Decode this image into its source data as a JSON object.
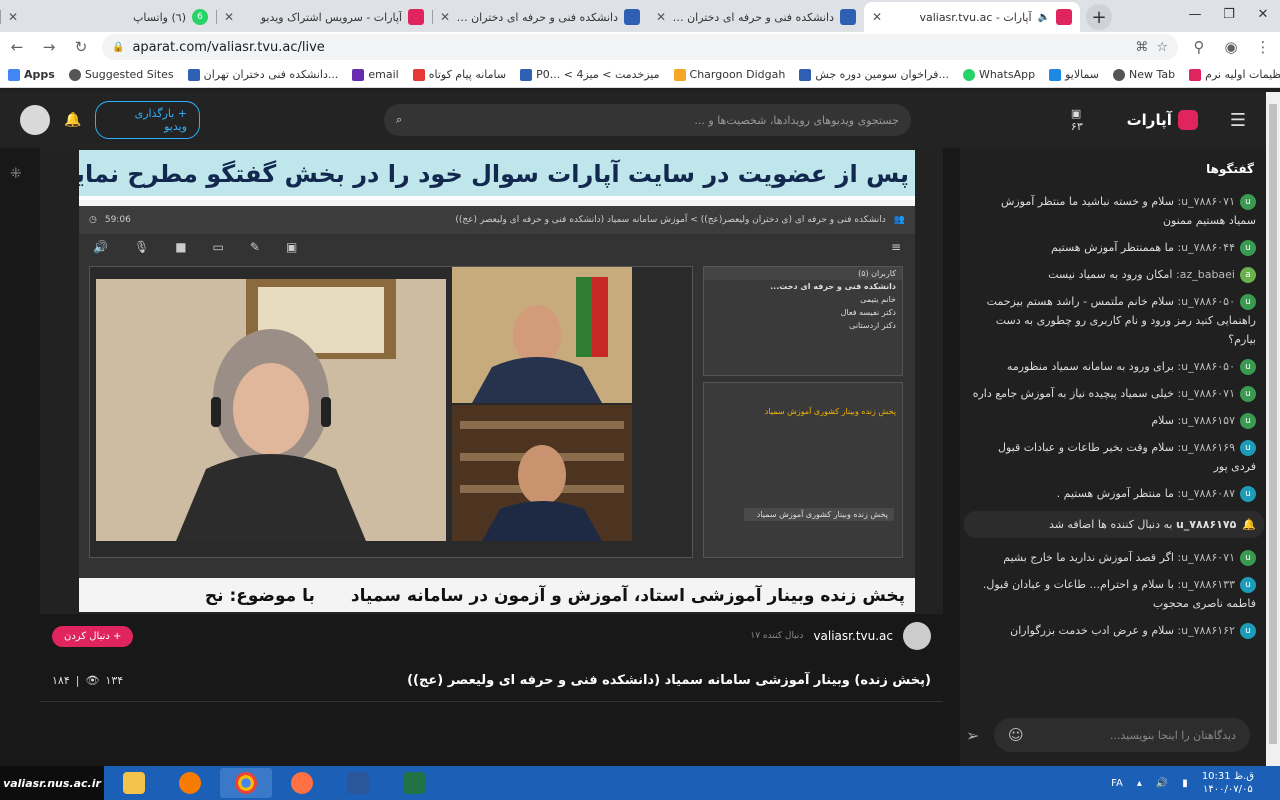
{
  "browser": {
    "tabs": [
      {
        "title": "(٦) واتساپ",
        "icon": "whatsapp",
        "active": false
      },
      {
        "title": "آپارات - سرویس اشتراک ویدیو",
        "icon": "aparat",
        "active": false
      },
      {
        "title": "دانشکده فنی و حرفه ای دختران ولیعصر(عج)",
        "icon": "tvu",
        "active": false
      },
      {
        "title": "دانشکده فنی و حرفه ای دختران ولیعصر(عج)",
        "icon": "tvu",
        "active": false
      },
      {
        "title": "آپارات - valiasr.tvu.ac",
        "icon": "aparat",
        "active": true
      }
    ],
    "url": "aparat.com/valiasr.tvu.ac/live",
    "bookmarks": [
      "Apps",
      "Suggested Sites",
      "دانشکده فنی دختران تهران...",
      "email",
      "سامانه پیام کوتاه",
      "P0... < میزخدمت > میز4",
      "Chargoon Didgah",
      "فراخوان سومین دوره جش...",
      "WhatsApp",
      "سمالایو",
      "New Tab",
      "آموزش تنظیمات اولیه نرم..."
    ]
  },
  "header": {
    "upload_label": "+ بارگذاری ویدیو",
    "search_placeholder": "جستجوی ویدیوهای رویدادها، شخصیت‌ها و ...",
    "live_count": "۶۳",
    "logo_text": "آپارات"
  },
  "video": {
    "banner": "پس از عضویت در سایت آپارات سوال خود را در بخش گفتگو مطرح نمایید",
    "room_title": "دانشکده فنی و حرفه ای (ی دختران ولیعصر(عج)) > آموزش سامانه سمیاد (دانشکده فنی و حرفه ای ولیعصر (عج))",
    "timer": "59:06",
    "participants_label": "کاربران (۵)",
    "participants": [
      "دانشکده فنی و حرفه ای دخت...",
      "خانم یتیمی",
      "دکتر نفیسه فعال",
      "دکتر اردستانی"
    ],
    "chat_msg1": "پخش زنده وبینار کشوری آموزش سمیاد",
    "chat_msg2": "پخش زنده وبینار کشوری آموزش سمیاد",
    "caption_left": "پخش زنده   وبینار آموزشی استاد، آموزش و آزمون در سامانه سمیاد",
    "caption_right": "با موضوع: نح"
  },
  "channel": {
    "follow_label": "+ دنبال کردن",
    "followers": "۱۷ دنبال کننده",
    "name": "valiasr.tvu.ac"
  },
  "video_title": "(پخش زنده) وبینار آموزشی سامانه سمیاد (دانشکده فنی و حرفه ای ولیعصر (عج))",
  "stats": {
    "views": "۱۳۴",
    "likes": "۱۸۴",
    "sep": "|"
  },
  "chat": {
    "heading": "گفتگوها",
    "messages": [
      {
        "user": "u_۷۸۸۶۰۷۱:",
        "text": "سلام و خسته نباشید ما منتظر آموزش سمیاد هستیم ممنون"
      },
      {
        "user": "u_۷۸۸۶۰۴۴:",
        "text": "ما هممنتظر آموزش هستیم"
      },
      {
        "user": "az_babaei:",
        "text": "امکان ورود به سمیاد نیست"
      },
      {
        "user": "u_۷۸۸۶۰۵۰:",
        "text": "سلام خانم ملتمس - راشد هستم بیزحمت راهنمایی کنید رمز ورود و نام کاربری رو چطوری به دست بیارم؟"
      },
      {
        "user": "u_۷۸۸۶۰۵۰:",
        "text": "برای ورود به سامانه سمیاد منظورمه"
      },
      {
        "user": "u_۷۸۸۶۰۷۱:",
        "text": "خیلی سمیاد پیچیده نیاز به آموزش جامع داره"
      },
      {
        "user": "u_۷۸۸۶۱۵۷:",
        "text": "سلام"
      },
      {
        "user": "u_۷۸۸۶۱۶۹:",
        "text": "سلام وقت بخیر طاعات و عبادات قبول فردی پور"
      },
      {
        "user": "u_۷۸۸۶۰۸۷:",
        "text": "ما منتظر آموزش هستیم ."
      },
      {
        "user": "u_۷۸۸۶۰۷۱:",
        "text": "اگر قصد آموزش ندارید ما خارج بشیم"
      },
      {
        "user": "u_۷۸۸۶۱۳۳:",
        "text": "با سلام و احترام... طاعات و عبادان قبول. فاطمه ناصری محجوب"
      },
      {
        "user": "u_۷۸۸۶۱۶۲:",
        "text": "سلام و عرض ادب خدمت بزرگواران"
      }
    ],
    "notice": {
      "user": "u_۷۸۸۶۱۷۵",
      "text": "به دنبال کننده ها اضافه شد"
    },
    "input_placeholder": "دیدگاهتان را اینجا بنویسید..."
  },
  "taskbar": {
    "brand": "valiasr.nus.ac.ir",
    "lang": "FA",
    "time": "10:31 ق.ظ",
    "date": "۱۴۰۰/۰۷/۰۵"
  },
  "colors": {
    "accent": "#e0245e",
    "chat_avatar": "#3a9a52",
    "taskbar": "#1b5fb6"
  }
}
